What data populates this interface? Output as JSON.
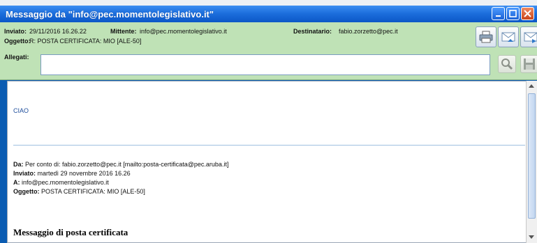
{
  "window": {
    "title": "Messaggio da \"info@pec.momentolegislativo.it\""
  },
  "header": {
    "inviato_label": "Inviato:",
    "inviato_value": "29/11/2016 16.26.22",
    "mittente_label": "Mittente:",
    "mittente_value": "info@pec.momentolegislativo.it",
    "destinatario_label": "Destinatario:",
    "destinatario_value": "fabio.zorzetto@pec.it",
    "oggetto_label": "Oggetto:",
    "oggetto_value": "R: POSTA CERTIFICATA: MIO [ALE-50]",
    "allegati_label": "Allegati:"
  },
  "toolbar": {
    "icons": [
      "print-icon",
      "reply-icon",
      "forward-icon",
      "search-icon",
      "save-icon"
    ]
  },
  "message": {
    "greeting": "CIAO",
    "da_label": "Da:",
    "da_value": "Per conto di: fabio.zorzetto@pec.it [mailto:posta-certificata@pec.aruba.it]",
    "inviato_label": "Inviato:",
    "inviato_value": "martedì 29 novembre 2016 16.26",
    "a_label": "A:",
    "a_value": "info@pec.momentolegislativo.it",
    "oggetto_label": "Oggetto:",
    "oggetto_value": "POSTA CERTIFICATA: MIO [ALE-50]",
    "heading": "Messaggio di posta certificata"
  },
  "colors": {
    "titlebar": "#1d6fdd",
    "header_bg": "#bfe2b6",
    "link_blue": "#1f4e9c"
  }
}
